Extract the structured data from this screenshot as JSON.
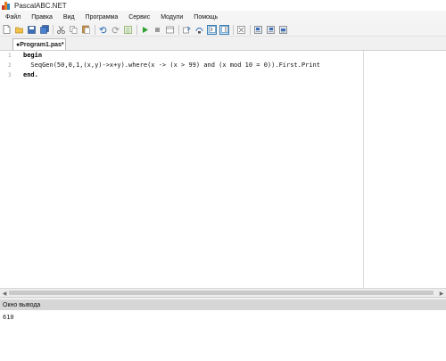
{
  "window": {
    "title": "PascalABC.NET"
  },
  "menu": [
    "Файл",
    "Правка",
    "Вид",
    "Программа",
    "Сервис",
    "Модули",
    "Помощь"
  ],
  "toolbar": {
    "buttons": [
      "new-file-icon",
      "open-folder-icon",
      "save-icon",
      "save-all-icon",
      "cut-icon",
      "copy-icon",
      "paste-icon",
      "undo-icon",
      "redo-icon",
      "format-icon",
      "run-icon",
      "stop-icon",
      "compile-icon",
      "debug-step-icon",
      "step-over-icon",
      "toggle-output-icon",
      "toggle-panel-icon",
      "settings-icon",
      "layout-1-icon",
      "layout-2-icon",
      "layout-3-icon"
    ]
  },
  "tab": {
    "label": "●Program1.pas*"
  },
  "code": {
    "line_numbers": [
      "1",
      "2",
      "3"
    ],
    "line1": "begin",
    "line2": "  SeqGen(50,0,1,(x,y)->x+y).where(x -> (x > 99) and (x mod 10 = 0)).First.Print",
    "line3": "end."
  },
  "output": {
    "title": "Окно вывода",
    "text": "610"
  }
}
